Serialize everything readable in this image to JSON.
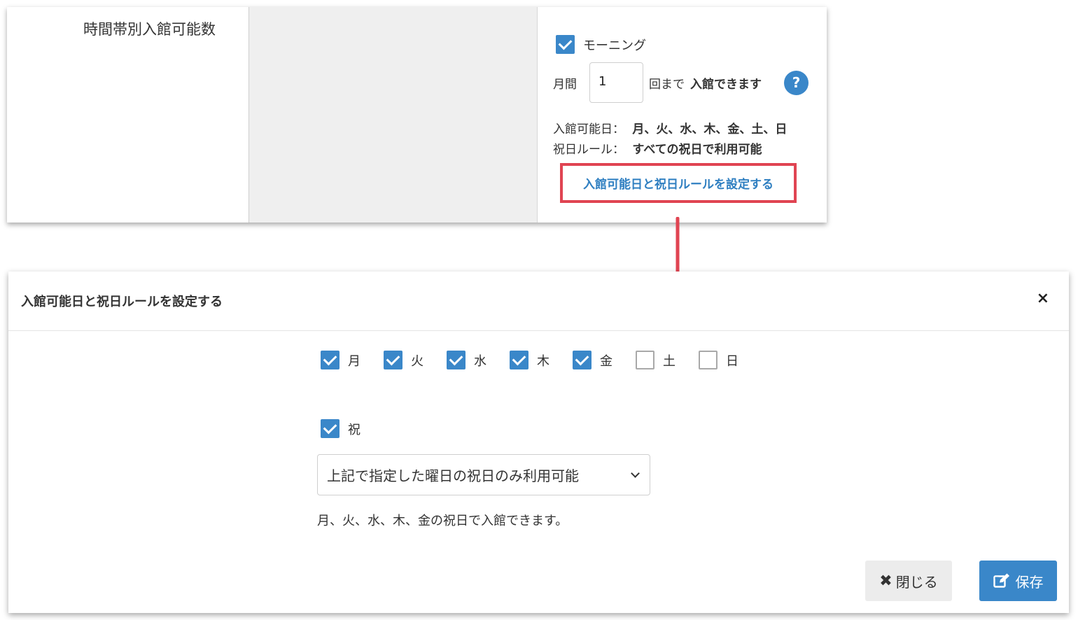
{
  "row": {
    "title": "時間帯別入館可能数"
  },
  "plan": {
    "name": "モーニング",
    "checked": true,
    "prefix": "月間",
    "count": "1",
    "suffix_plain": "回まで",
    "suffix_bold": "入館できます",
    "help_label": "?"
  },
  "info": {
    "days_label": "入館可能日：",
    "days_value": "月、火、水、木、金、土、日",
    "holiday_label": "祝日ルール：",
    "holiday_value": "すべての祝日で利用可能"
  },
  "set_link": "入館可能日と祝日ルールを設定する",
  "modal": {
    "title": "入館可能日と祝日ルールを設定する",
    "close_icon": "×",
    "days": [
      {
        "label": "月",
        "checked": true
      },
      {
        "label": "火",
        "checked": true
      },
      {
        "label": "水",
        "checked": true
      },
      {
        "label": "木",
        "checked": true
      },
      {
        "label": "金",
        "checked": true
      },
      {
        "label": "土",
        "checked": false
      },
      {
        "label": "日",
        "checked": false
      }
    ],
    "holiday": {
      "label": "祝",
      "checked": true
    },
    "holiday_select_value": "上記で指定した曜日の祝日のみ利用可能",
    "note": "月、火、水、木、金の祝日で入館できます。",
    "close_button": "閉じる",
    "save_button": "保存"
  },
  "colors": {
    "accent": "#3a87c9",
    "highlight": "#e04452"
  }
}
